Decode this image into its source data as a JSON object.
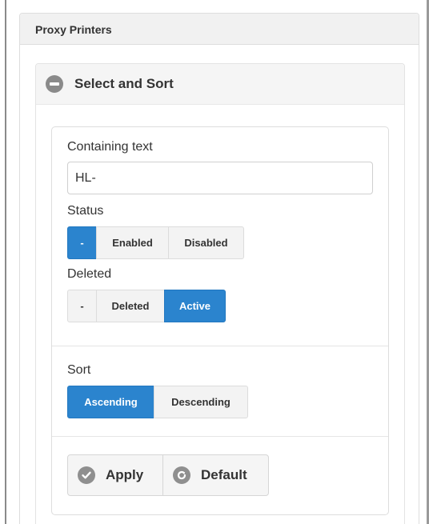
{
  "panel": {
    "title": "Proxy Printers"
  },
  "accordion": {
    "title": "Select and Sort",
    "icon": "collapse-minus-icon"
  },
  "filters": {
    "containing_text_label": "Containing text",
    "containing_text_value": "HL-",
    "status_label": "Status",
    "status_options": [
      "-",
      "Enabled",
      "Disabled"
    ],
    "status_selected": "-",
    "deleted_label": "Deleted",
    "deleted_options": [
      "-",
      "Deleted",
      "Active"
    ],
    "deleted_selected": "Active"
  },
  "sort": {
    "label": "Sort",
    "options": [
      "Ascending",
      "Descending"
    ],
    "selected": "Ascending"
  },
  "actions": {
    "apply_label": "Apply",
    "apply_icon": "check-circle-icon",
    "default_label": "Default",
    "default_icon": "refresh-circle-icon"
  },
  "colors": {
    "accent": "#2b84ce",
    "icon_gray": "#8f8f8f"
  }
}
